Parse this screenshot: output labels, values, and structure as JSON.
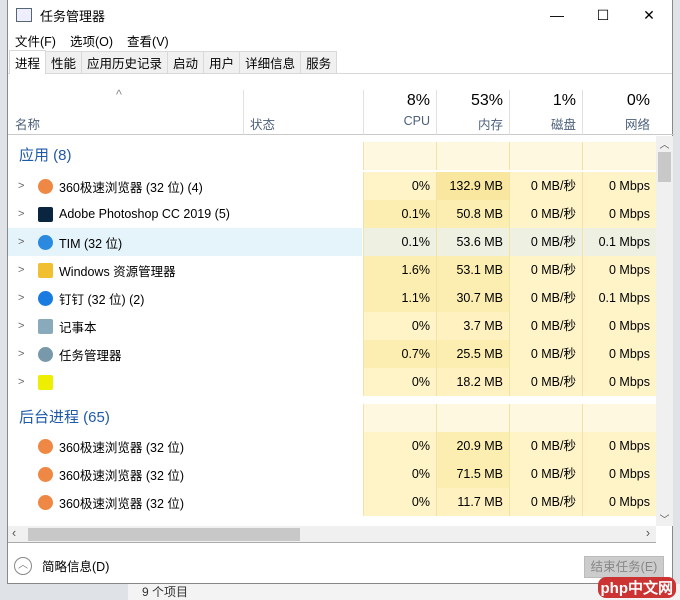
{
  "window": {
    "title": "任务管理器",
    "min": "—",
    "max": "☐",
    "close": "✕"
  },
  "menu": [
    "文件(F)",
    "选项(O)",
    "查看(V)"
  ],
  "tabs": [
    "进程",
    "性能",
    "应用历史记录",
    "启动",
    "用户",
    "详细信息",
    "服务"
  ],
  "columns": {
    "name": "名称",
    "status": "状态",
    "cpu": {
      "pct": "8%",
      "label": "CPU"
    },
    "mem": {
      "pct": "53%",
      "label": "内存"
    },
    "disk": {
      "pct": "1%",
      "label": "磁盘"
    },
    "net": {
      "pct": "0%",
      "label": "网络"
    }
  },
  "groups": [
    {
      "title": "应用 (8)",
      "rows": [
        {
          "name": "360极速浏览器 (32 位) (4)",
          "icon": "browser-360-icon",
          "color": "#e84",
          "expand": true,
          "cpu": "0%",
          "mem": "132.9 MB",
          "disk": "0 MB/秒",
          "net": "0 Mbps"
        },
        {
          "name": "Adobe Photoshop CC 2019 (5)",
          "icon": "photoshop-icon",
          "color": "#0a2540",
          "expand": true,
          "cpu": "0.1%",
          "mem": "50.8 MB",
          "disk": "0 MB/秒",
          "net": "0 Mbps"
        },
        {
          "name": "TIM (32 位)",
          "icon": "tim-icon",
          "color": "#2a8ae0",
          "expand": true,
          "hover": true,
          "cpu": "0.1%",
          "mem": "53.6 MB",
          "disk": "0 MB/秒",
          "net": "0.1 Mbps"
        },
        {
          "name": "Windows 资源管理器",
          "icon": "explorer-icon",
          "color": "#f0c030",
          "expand": true,
          "cpu": "1.6%",
          "mem": "53.1 MB",
          "disk": "0 MB/秒",
          "net": "0 Mbps"
        },
        {
          "name": "钉钉 (32 位) (2)",
          "icon": "dingtalk-icon",
          "color": "#1a7be0",
          "expand": true,
          "cpu": "1.1%",
          "mem": "30.7 MB",
          "disk": "0 MB/秒",
          "net": "0.1 Mbps"
        },
        {
          "name": "记事本",
          "icon": "notepad-icon",
          "color": "#8ab",
          "expand": true,
          "cpu": "0%",
          "mem": "3.7 MB",
          "disk": "0 MB/秒",
          "net": "0 Mbps"
        },
        {
          "name": "任务管理器",
          "icon": "task-manager-icon",
          "color": "#79a",
          "expand": true,
          "cpu": "0.7%",
          "mem": "25.5 MB",
          "disk": "0 MB/秒",
          "net": "0 Mbps"
        },
        {
          "name": "",
          "icon": "app-icon",
          "color": "#ee0",
          "expand": true,
          "cpu": "0%",
          "mem": "18.2 MB",
          "disk": "0 MB/秒",
          "net": "0 Mbps"
        }
      ]
    },
    {
      "title": "后台进程 (65)",
      "rows": [
        {
          "name": "360极速浏览器 (32 位)",
          "icon": "browser-360-icon",
          "color": "#e84",
          "expand": false,
          "cpu": "0%",
          "mem": "20.9 MB",
          "disk": "0 MB/秒",
          "net": "0 Mbps"
        },
        {
          "name": "360极速浏览器 (32 位)",
          "icon": "browser-360-icon",
          "color": "#e84",
          "expand": false,
          "cpu": "0%",
          "mem": "71.5 MB",
          "disk": "0 MB/秒",
          "net": "0 Mbps"
        },
        {
          "name": "360极速浏览器 (32 位)",
          "icon": "browser-360-icon",
          "color": "#e84",
          "expand": false,
          "cpu": "0%",
          "mem": "11.7 MB",
          "disk": "0 MB/秒",
          "net": "0 Mbps"
        }
      ]
    }
  ],
  "footer": {
    "details": "简略信息(D)",
    "end_task": "结束任务(E)"
  },
  "behind": {
    "status": "9 个项目"
  },
  "watermark": "php中文网"
}
